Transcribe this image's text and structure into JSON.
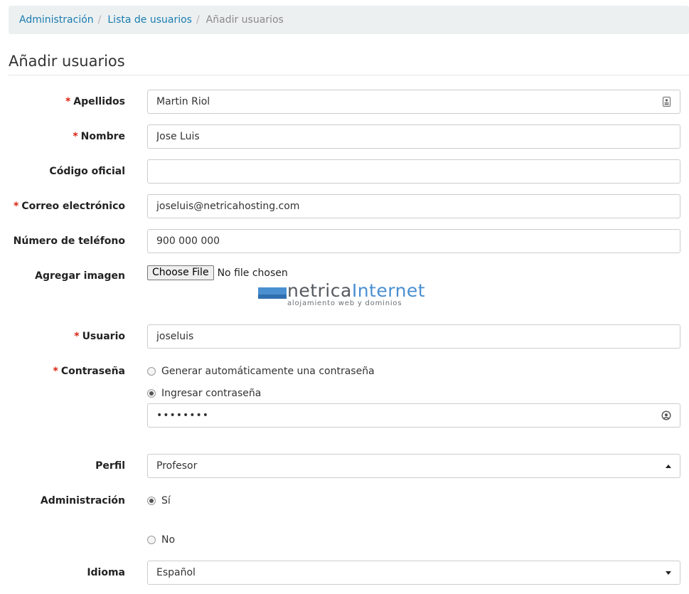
{
  "breadcrumb": {
    "items": [
      "Administración",
      "Lista de usuarios"
    ],
    "separator": "/",
    "current": "Añadir usuarios"
  },
  "page_title": "Añadir usuarios",
  "required_mark": "*",
  "fields": {
    "apellidos": {
      "label": "Apellidos",
      "value": "Martin Riol"
    },
    "nombre": {
      "label": "Nombre",
      "value": "Jose Luis"
    },
    "codigo_oficial": {
      "label": "Código oficial",
      "value": ""
    },
    "correo": {
      "label": "Correo electrónico",
      "value": "joseluis@netricahosting.com"
    },
    "telefono": {
      "label": "Número de teléfono",
      "value": "900 000 000"
    },
    "imagen": {
      "label": "Agregar imagen",
      "button": "Choose File",
      "status": "No file chosen"
    },
    "usuario": {
      "label": "Usuario",
      "value": "joseluis"
    },
    "contrasena": {
      "label": "Contraseña",
      "option_auto": "Generar automáticamente una contraseña",
      "option_manual": "Ingresar contraseña",
      "selected": "manual",
      "value": "••••••••"
    },
    "perfil": {
      "label": "Perfil",
      "value": "Profesor"
    },
    "administracion": {
      "label": "Administración",
      "option_yes": "Sí",
      "option_no": "No",
      "selected": "yes"
    },
    "idioma": {
      "label": "Idioma",
      "value": "Español"
    }
  },
  "logo": {
    "name_part1": "netrica",
    "name_part2": "Internet",
    "tagline": "alojamiento web y dominios"
  },
  "icons": {
    "contact_card": "contact-card-icon",
    "password_reveal": "password-reveal-icon"
  },
  "colors": {
    "link": "#1a7cb0",
    "required": "#d9230f",
    "breadcrumb_bg": "#ecf0f1"
  }
}
